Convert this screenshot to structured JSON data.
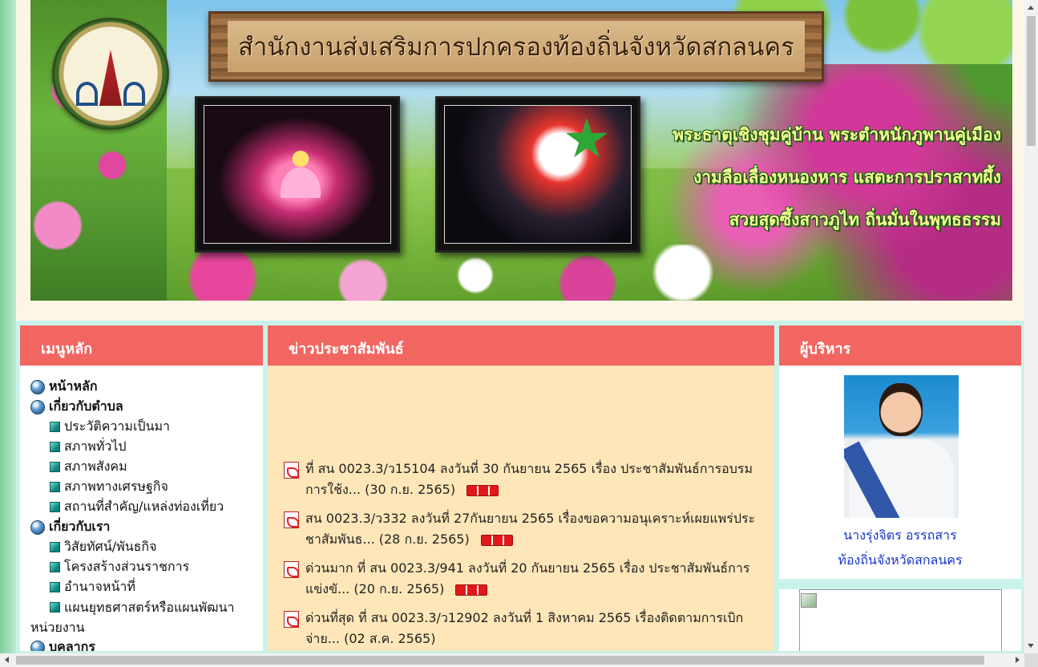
{
  "banner": {
    "title": "สำนักงานส่งเสริมการปกครองท้องถิ่นจังหวัดสกลนคร",
    "slogan_lines": [
      "พระธาตุเชิงชุมคู่บ้าน  พระตำหนักภูพานคู่เมือง",
      "งามลือเลื่องหนองหาร  แสตะการปราสาทผึ้ง",
      "สวยสุดซึ้งสาวภูไท  ถิ่นมั่นในพุทธธรรม"
    ]
  },
  "menu": {
    "heading": "เมนูหลัก",
    "items": [
      {
        "label": "หน้าหลัก",
        "level": "main"
      },
      {
        "label": "เกี่ยวกับตำบล",
        "level": "main"
      },
      {
        "label": "ประวัติความเป็นมา",
        "level": "sub"
      },
      {
        "label": "สภาพทั่วไป",
        "level": "sub"
      },
      {
        "label": "สภาพสังคม",
        "level": "sub"
      },
      {
        "label": "สภาพทางเศรษฐกิจ",
        "level": "sub"
      },
      {
        "label": "สถานที่สำคัญ/แหล่งท่องเที่ยว",
        "level": "sub"
      },
      {
        "label": "เกี่ยวกับเรา",
        "level": "main"
      },
      {
        "label": "วิสัยทัศน์/พันธกิจ",
        "level": "sub"
      },
      {
        "label": "โครงสร้างส่วนราชการ",
        "level": "sub"
      },
      {
        "label": "อำนาจหน้าที่",
        "level": "sub"
      },
      {
        "label": "แผนยุทธศาสตร์หรือแผนพัฒนา",
        "label_line2": "หน่วยงาน",
        "level": "sub"
      },
      {
        "label": "บุคลากร",
        "level": "main"
      }
    ]
  },
  "news": {
    "heading": "ข่าวประชาสัมพันธ์",
    "items": [
      {
        "text": "ที่ สน 0023.3/ว15104 ลงวันที่ 30 กันยายน 2565 เรื่อง ประชาสัมพันธ์การอบรมการใช้ง... (30 ก.ย. 2565)"
      },
      {
        "text": "สน 0023.3/ว332 ลงวันที่ 27กันยายน 2565 เรื่องขอความอนุเคราะห์เผยแพร่ประชาสัมพันธ... (28 ก.ย. 2565)"
      },
      {
        "text": "ด่วนมาก ที่ สน 0023.3/941 ลงวันที่ 20 กันยายน 2565 เรื่อง ประชาสัมพันธ์การแข่งขั... (20 ก.ย. 2565)"
      },
      {
        "text": "ด่วนที่สุด ที่ สน 0023.3/ว12902 ลงวันที่ 1 สิงหาคม 2565 เรื่องติดตามการเบิกจ่าย... (02 ส.ค. 2565)"
      }
    ]
  },
  "executive": {
    "heading": "ผู้บริหาร",
    "name": "นางรุ่งจิตร อรรถสาร",
    "position": "ท้องถิ่นจังหวัดสกลนคร"
  },
  "colors": {
    "header_red": "#f26661",
    "news_bg": "#ffe6b8",
    "page_bg": "#c9f3ea",
    "link_blue": "#1736c8"
  }
}
